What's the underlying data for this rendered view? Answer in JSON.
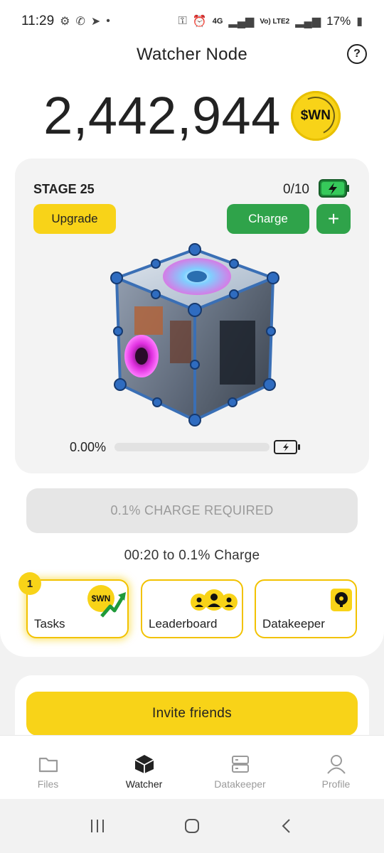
{
  "status_bar": {
    "time": "11:29",
    "network": "4G",
    "network_sub": "Vo) LTE2",
    "battery": "17%"
  },
  "header": {
    "title": "Watcher Node"
  },
  "balance": {
    "value": "2,442,944",
    "token": "$WN"
  },
  "stage": {
    "label": "STAGE 25",
    "charges": "0/10",
    "upgrade_label": "Upgrade",
    "charge_label": "Charge",
    "plus_label": "+",
    "progress_text": "0.00%",
    "progress_fraction": 0.0
  },
  "required": {
    "label": "0.1% CHARGE REQUIRED"
  },
  "timer": {
    "text": "00:20 to 0.1% Charge"
  },
  "tiles": {
    "badge": "1",
    "tasks": "Tasks",
    "tasks_coin": "$WN",
    "leaderboard": "Leaderboard",
    "datakeeper": "Datakeeper"
  },
  "invite": {
    "label": "Invite friends"
  },
  "nav": {
    "files": "Files",
    "watcher": "Watcher",
    "datakeeper": "Datakeeper",
    "profile": "Profile"
  },
  "colors": {
    "accent_yellow": "#f8d318",
    "accent_green": "#2fa34a",
    "disabled_grey": "#e6e6e6"
  },
  "icons": {
    "status": [
      "gear-icon",
      "whatsapp-icon",
      "telegram-icon",
      "key-icon",
      "alarm-icon",
      "signal-icon",
      "battery-icon"
    ],
    "nav": [
      "folder-icon",
      "cube-icon",
      "server-icon",
      "person-icon"
    ],
    "system": [
      "recents-icon",
      "home-icon",
      "back-icon"
    ]
  }
}
